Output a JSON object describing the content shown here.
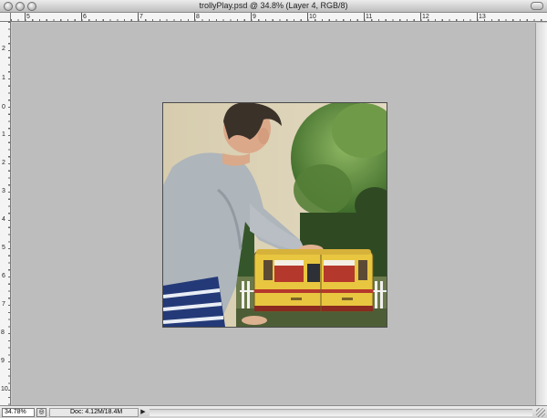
{
  "window": {
    "title": "trollyPlay.psd @ 34.8% (Layer 4, RGB/8)"
  },
  "rulers": {
    "top_labels": [
      "5",
      "6",
      "7",
      "8",
      "9",
      "10",
      "11",
      "12",
      "13"
    ],
    "left_labels": [
      "2",
      "1",
      "0",
      "1",
      "2",
      "3",
      "4",
      "5",
      "6",
      "7",
      "8",
      "9",
      "10",
      "11"
    ]
  },
  "status": {
    "zoom": "34.78%",
    "doc_info": "Doc: 4.12M/18.4M"
  },
  "colors": {
    "canvas_bg": "#bdbdbd",
    "trolley_yellow": "#e8c640",
    "trolley_red": "#b5382c",
    "shirt_gray": "#aeb5bb"
  }
}
